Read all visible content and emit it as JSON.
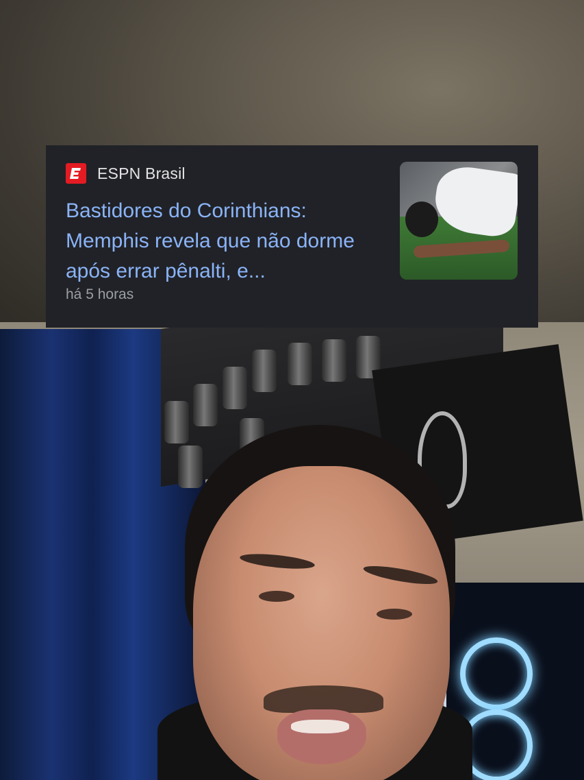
{
  "notification": {
    "app_name": "ESPN Brasil",
    "app_icon": "espn-e-logo",
    "headline": "Bastidores do Corinthians: Memphis revela que não dorme após errar pênalti, e...",
    "time": "há 5 horas",
    "thumbnail": "player-kneeling-on-pitch-image"
  },
  "colors": {
    "card_background": "#212227",
    "headline": "#8ab4f8",
    "app_name": "#e3e3e3",
    "time": "#9aa0a6",
    "espn_red": "#e41b23"
  }
}
